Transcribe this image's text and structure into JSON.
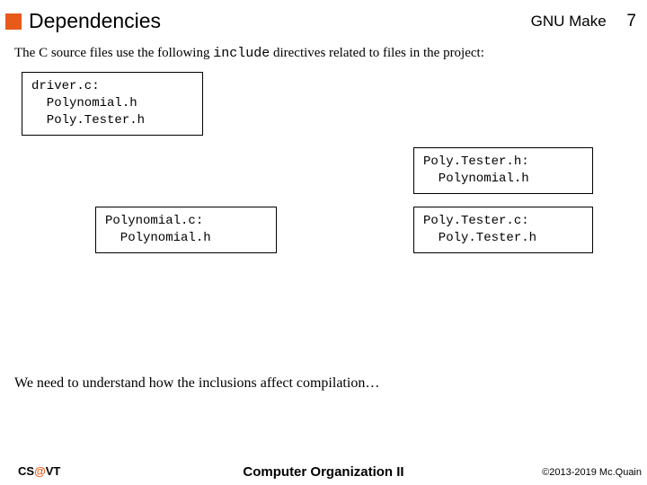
{
  "header": {
    "title": "Dependencies",
    "context": "GNU Make",
    "page": "7"
  },
  "intro": {
    "pre": "The C source files use the following ",
    "code": "include",
    "post": " directives related to files in the project:"
  },
  "boxes": {
    "b1": "driver.c:\n  Polynomial.h\n  Poly.Tester.h",
    "b2": "Poly.Tester.h:\n  Polynomial.h",
    "b3": "Polynomial.c:\n  Polynomial.h",
    "b4": "Poly.Tester.c:\n  Poly.Tester.h"
  },
  "outro": "We need to understand how the inclusions affect compilation…",
  "footer": {
    "left_cs": "CS",
    "left_at": "@",
    "left_vt": "VT",
    "center": "Computer Organization II",
    "right": "©2013-2019 Mc.Quain"
  }
}
